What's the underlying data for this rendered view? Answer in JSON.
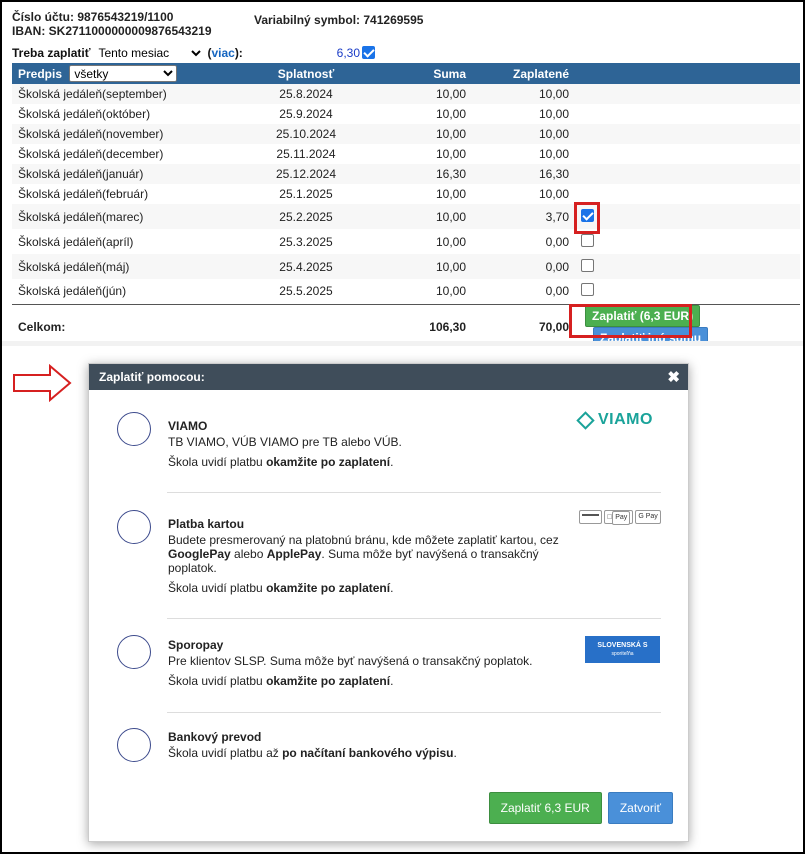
{
  "account": {
    "number_line": "Číslo účtu: 9876543219/1100",
    "iban_line": "IBAN: SK2711000000009876543219",
    "vs_line": "Variabilný symbol: 741269595"
  },
  "filter": {
    "label": "Treba zaplatiť",
    "period_selected": "Tento mesiac",
    "more_open": "(",
    "more_link": "viac",
    "more_close": "):",
    "amount": "6,30",
    "checked": true
  },
  "table": {
    "headers": {
      "predpis": "Predpis",
      "filter_selected": "všetky",
      "splatnost": "Splatnosť",
      "suma": "Suma",
      "zaplatene": "Zaplatené"
    },
    "rows": [
      {
        "name": "Školská jedáleň(september)",
        "due": "25.8.2024",
        "amount": "10,00",
        "paid": "10,00",
        "status": "paid"
      },
      {
        "name": "Školská jedáleň(október)",
        "due": "25.9.2024",
        "amount": "10,00",
        "paid": "10,00",
        "status": "paid"
      },
      {
        "name": "Školská jedáleň(november)",
        "due": "25.10.2024",
        "amount": "10,00",
        "paid": "10,00",
        "status": "paid"
      },
      {
        "name": "Školská jedáleň(december)",
        "due": "25.11.2024",
        "amount": "10,00",
        "paid": "10,00",
        "status": "paid"
      },
      {
        "name": "Školská jedáleň(január)",
        "due": "25.12.2024",
        "amount": "16,30",
        "paid": "16,30",
        "status": "paid"
      },
      {
        "name": "Školská jedáleň(február)",
        "due": "25.1.2025",
        "amount": "10,00",
        "paid": "10,00",
        "status": "paid"
      },
      {
        "name": "Školská jedáleň(marec)",
        "due": "25.2.2025",
        "amount": "10,00",
        "paid": "3,70",
        "status": "unpaid",
        "checked": true
      },
      {
        "name": "Školská jedáleň(apríl)",
        "due": "25.3.2025",
        "amount": "10,00",
        "paid": "0,00",
        "status": "unpaid",
        "checked": false
      },
      {
        "name": "Školská jedáleň(máj)",
        "due": "25.4.2025",
        "amount": "10,00",
        "paid": "0,00",
        "status": "unpaid",
        "checked": false
      },
      {
        "name": "Školská jedáleň(jún)",
        "due": "25.5.2025",
        "amount": "10,00",
        "paid": "0,00",
        "status": "unpaid",
        "checked": false
      }
    ],
    "total": {
      "label": "Celkom:",
      "amount": "106,30",
      "paid": "70,00"
    },
    "pay_button": "Zaplatiť (6,3 EUR)",
    "pay_other_button": "Zaplatiť inú sumu"
  },
  "modal": {
    "title": "Zaplatiť pomocou:",
    "close_glyph": "✖",
    "options": [
      {
        "name": "VIAMO",
        "desc": "TB VIAMO, VÚB VIAMO pre TB alebo VÚB.",
        "note_pre": "Škola uvidí platbu ",
        "note_bold": "okamžite po zaplatení",
        "note_post": ".",
        "logo_text": "VIAMO"
      },
      {
        "name": "Platba kartou",
        "desc_1": "Budete presmerovaný na platobnú bránu, kde môžete zaplatiť kartou, cez ",
        "desc_b1": "GooglePay",
        "desc_2": " alebo ",
        "desc_b2": "ApplePay",
        "desc_3": ". Suma môže byť navýšená o transakčný poplatok.",
        "note_pre": "Škola uvidí platbu ",
        "note_bold": "okamžite po zaplatení",
        "note_post": ".",
        "logo_apple": "Pay",
        "logo_google": "G Pay"
      },
      {
        "name": "Sporopay",
        "desc": "Pre klientov SLSP. Suma môže byť navýšená o transakčný poplatok.",
        "note_pre": "Škola uvidí platbu ",
        "note_bold": "okamžite po zaplatení",
        "note_post": ".",
        "logo_text": "SLOVENSKÁ S",
        "logo_sub": "sporiteľňa"
      },
      {
        "name": "Bankový prevod",
        "note_pre": "Škola uvidí platbu až ",
        "note_bold": "po načítaní bankového výpisu",
        "note_post": "."
      }
    ],
    "pay_button": "Zaplatiť 6,3 EUR",
    "close_button": "Zatvoriť"
  },
  "colors": {
    "header_blue": "#2e6496",
    "paid_green": "#1b8a1b",
    "unpaid_red": "#c0392b",
    "highlight_red": "#d62020",
    "modal_head": "#3f4d5a"
  }
}
